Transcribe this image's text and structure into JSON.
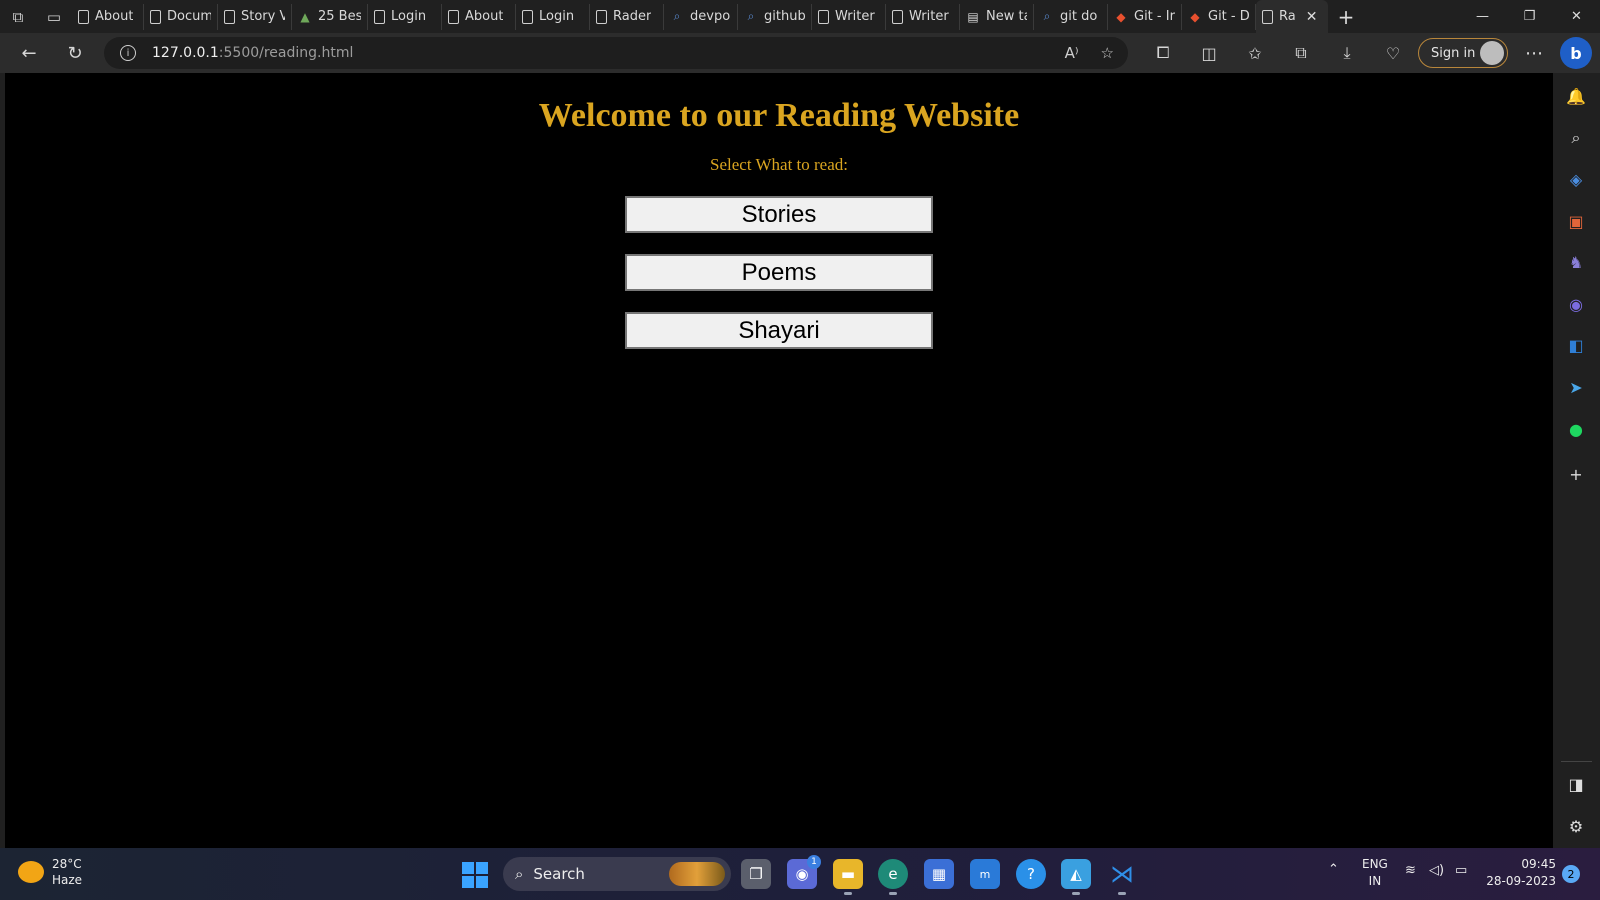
{
  "browser": {
    "tabs": [
      {
        "label": "About",
        "icon": "doc-icon"
      },
      {
        "label": "Docum",
        "icon": "doc-icon"
      },
      {
        "label": "Story V",
        "icon": "doc-icon"
      },
      {
        "label": "25 Bes",
        "icon": "image-icon"
      },
      {
        "label": "Login",
        "icon": "doc-icon"
      },
      {
        "label": "About",
        "icon": "doc-icon"
      },
      {
        "label": "Login",
        "icon": "doc-icon"
      },
      {
        "label": "Rader",
        "icon": "doc-icon"
      },
      {
        "label": "devpo",
        "icon": "search-icon"
      },
      {
        "label": "github",
        "icon": "search-icon"
      },
      {
        "label": "Writer",
        "icon": "doc-icon"
      },
      {
        "label": "Writer",
        "icon": "doc-icon"
      },
      {
        "label": "New ta",
        "icon": "newtab-icon"
      },
      {
        "label": "git do",
        "icon": "search-icon"
      },
      {
        "label": "Git - Ir",
        "icon": "git-icon"
      },
      {
        "label": "Git - D",
        "icon": "git-icon"
      },
      {
        "label": "Ra",
        "icon": "doc-icon"
      }
    ],
    "url_host": "127.0.0.1",
    "url_path": ":5500/reading.html",
    "sign_in": "Sign in"
  },
  "page": {
    "title": "Welcome to our Reading Website",
    "subtitle": "Select What to read:",
    "buttons": [
      "Stories",
      "Poems",
      "Shayari"
    ]
  },
  "taskbar": {
    "temperature": "28°C",
    "condition": "Haze",
    "search": "Search",
    "language": "ENG",
    "region": "IN",
    "time": "09:45",
    "date": "28-09-2023",
    "notifications": "2",
    "chat_badge": "1"
  },
  "colors": {
    "accent": "#daa520",
    "page_bg": "#000000"
  }
}
